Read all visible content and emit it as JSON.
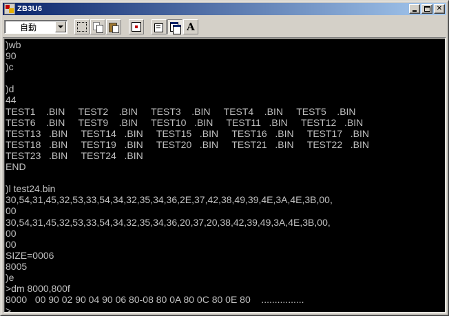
{
  "window": {
    "title": "ZB3U6",
    "icons": {
      "app": "app-icon",
      "minimize": "minimize-icon",
      "maximize": "maximize-icon",
      "close": "close-icon"
    },
    "close_glyph": "✕"
  },
  "toolbar": {
    "font_mode": "自動",
    "buttons": [
      {
        "name": "select-button",
        "icon": "select-icon"
      },
      {
        "name": "copy-button",
        "icon": "copy-icon"
      },
      {
        "name": "paste-button",
        "icon": "paste-icon"
      },
      {
        "name": "fullscreen-button",
        "icon": "fullscreen-icon"
      },
      {
        "name": "properties-button",
        "icon": "properties-icon"
      },
      {
        "name": "background-button",
        "icon": "background-icon"
      },
      {
        "name": "font-button",
        "icon": "font-icon",
        "label": "A"
      }
    ]
  },
  "console": {
    "background": "#000000",
    "foreground": "#c0c0c0",
    "lines": [
      ")wb",
      "90",
      ")c",
      "",
      ")d",
      "44",
      "TEST1    .BIN     TEST2    .BIN     TEST3    .BIN     TEST4    .BIN     TEST5    .BIN",
      "TEST6    .BIN     TEST9    .BIN     TEST10   .BIN     TEST11   .BIN     TEST12   .BIN",
      "TEST13   .BIN     TEST14   .BIN     TEST15   .BIN     TEST16   .BIN     TEST17   .BIN",
      "TEST18   .BIN     TEST19   .BIN     TEST20   .BIN     TEST21   .BIN     TEST22   .BIN",
      "TEST23   .BIN     TEST24   .BIN",
      "END",
      "",
      ")l test24.bin",
      "30,54,31,45,32,53,33,54,34,32,35,34,36,2E,37,42,38,49,39,4E,3A,4E,3B,00,",
      "00",
      "30,54,31,45,32,53,33,54,34,32,35,34,36,20,37,20,38,42,39,49,3A,4E,3B,00,",
      "00",
      "00",
      "SIZE=0006",
      "8005",
      ")e",
      ">dm 8000,800f",
      "8000   00 90 02 90 04 90 06 80-08 80 0A 80 0C 80 0E 80    ................",
      ">"
    ]
  }
}
